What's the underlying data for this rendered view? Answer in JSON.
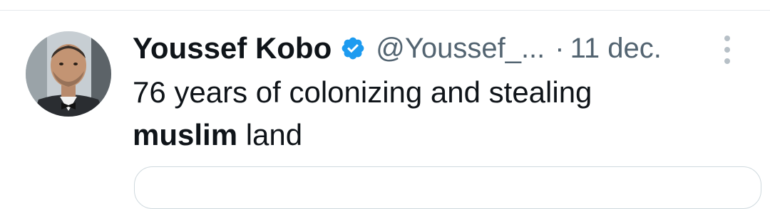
{
  "tweet": {
    "display_name": "Youssef Kobo",
    "handle": "@Youssef_...",
    "separator": "·",
    "timestamp": "11 dec.",
    "text_line1": "76 years of colonizing and stealing",
    "text_bold": "muslim",
    "text_rest": " land"
  },
  "icons": {
    "verified": "verified-badge-icon",
    "more": "more-vertical-icon"
  },
  "colors": {
    "text_primary": "#0f1419",
    "text_secondary": "#536471",
    "verified_blue": "#1d9bf0",
    "divider": "#e6e9ec"
  }
}
